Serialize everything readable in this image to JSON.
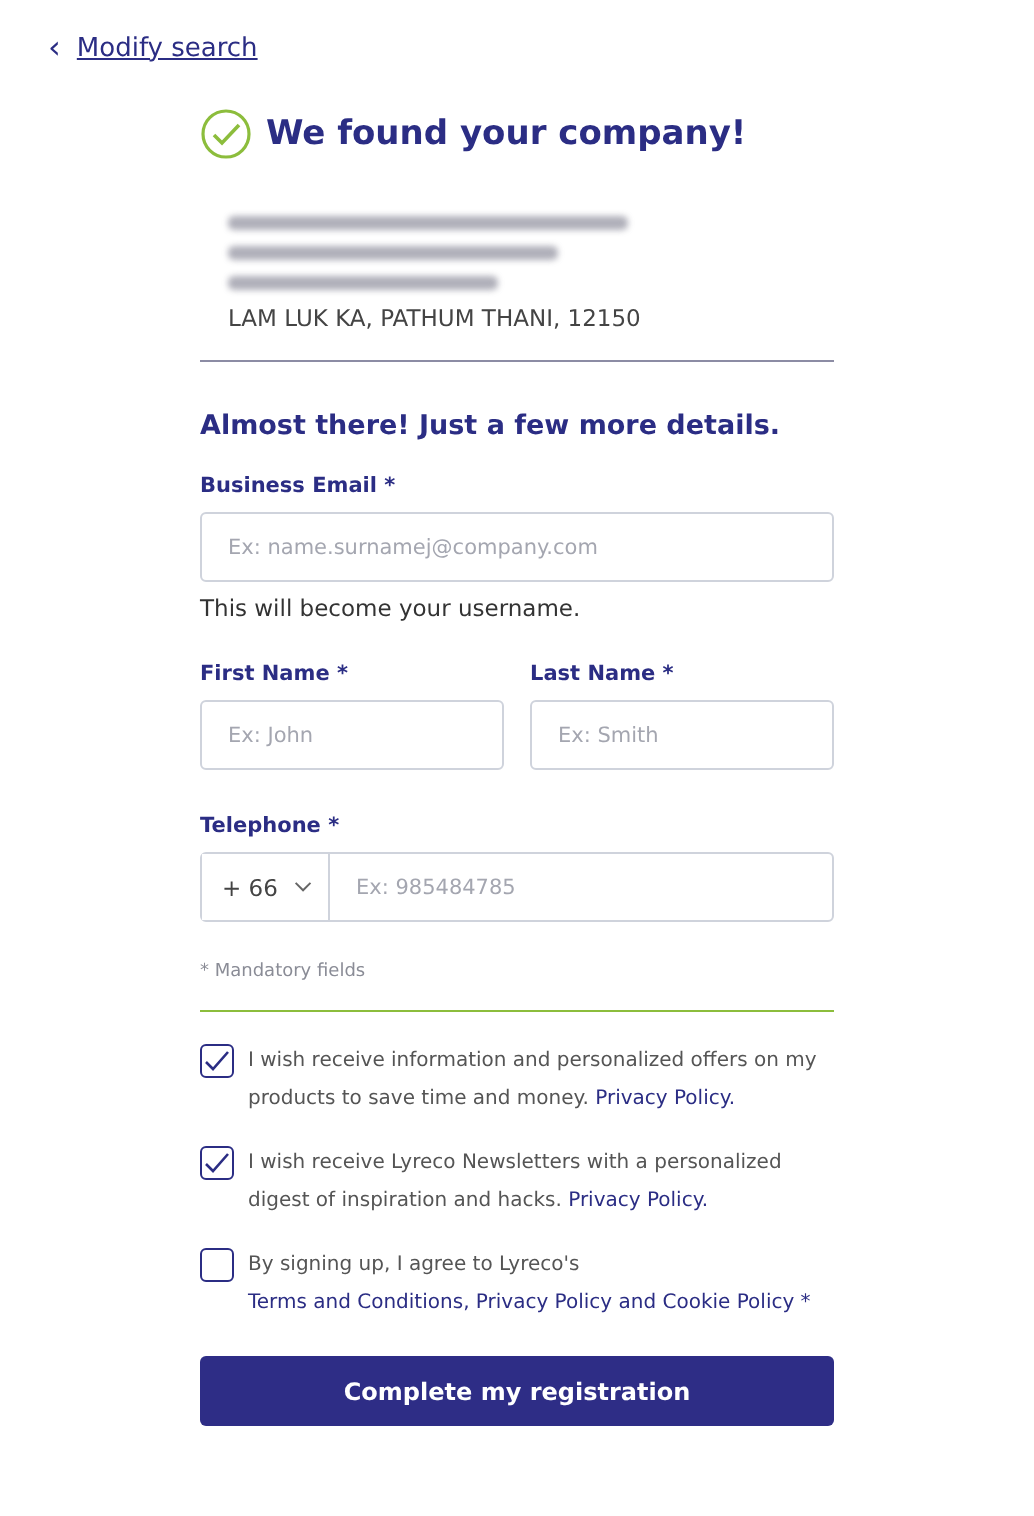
{
  "back_link": {
    "icon": "‹",
    "label": "Modify search"
  },
  "found": {
    "title": "We found your company!",
    "address": "LAM LUK KA, PATHUM THANI, 12150"
  },
  "form": {
    "title": "Almost there! Just a few more details.",
    "email": {
      "label": "Business Email *",
      "placeholder": "Ex: name.surnamej@company.com",
      "help": "This will become your username."
    },
    "first_name": {
      "label": "First Name *",
      "placeholder": "Ex: John"
    },
    "last_name": {
      "label": "Last Name *",
      "placeholder": "Ex: Smith"
    },
    "telephone": {
      "label": "Telephone *",
      "country_code": "+ 66",
      "placeholder": "Ex: 985484785"
    },
    "mandatory_note": "* Mandatory fields"
  },
  "consents": [
    {
      "checked": true,
      "segments": [
        {
          "kind": "plain",
          "text": "I wish receive information and personalized offers on my products to save time and money. "
        },
        {
          "kind": "link",
          "text": "Privacy Policy."
        }
      ]
    },
    {
      "checked": true,
      "segments": [
        {
          "kind": "plain",
          "text": "I wish receive Lyreco Newsletters with a personalized digest of inspiration and hacks. "
        },
        {
          "kind": "link",
          "text": "Privacy Policy."
        }
      ]
    },
    {
      "checked": false,
      "segments": [
        {
          "kind": "plain",
          "text": "By signing up, I agree to Lyreco's "
        },
        {
          "kind": "link",
          "text": "Terms and Conditions"
        },
        {
          "kind": "link",
          "text": ", Privacy Policy"
        },
        {
          "kind": "link",
          "text": " and Cookie Policy *"
        }
      ]
    }
  ],
  "submit": {
    "label": "Complete my registration"
  }
}
